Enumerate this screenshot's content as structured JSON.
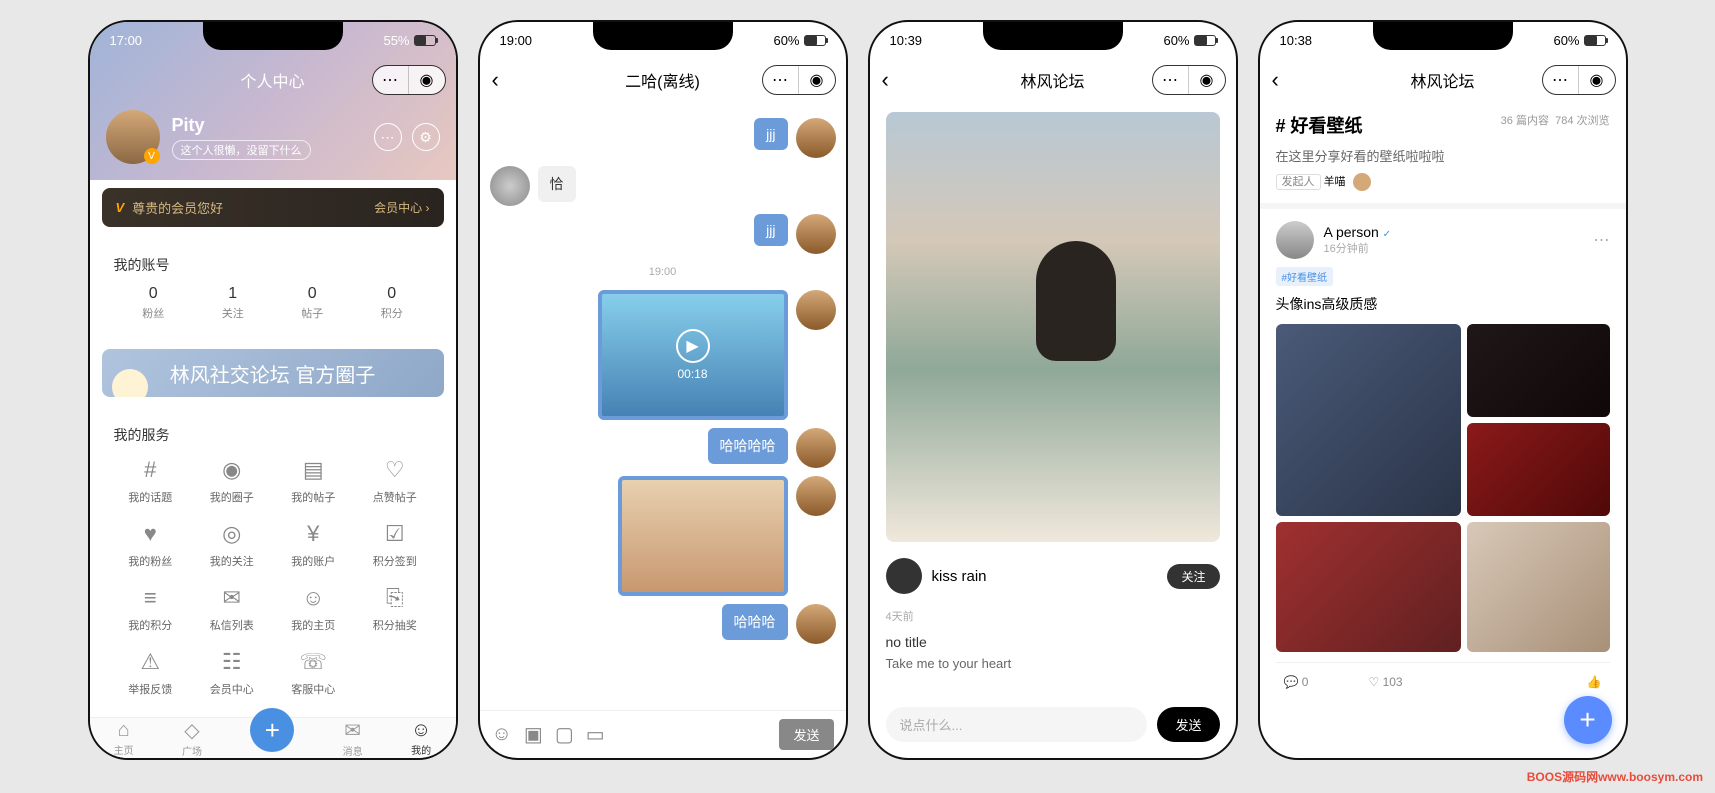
{
  "watermark": "BOOS源码网www.boosym.com",
  "p1": {
    "time": "17:00",
    "battery": "55%",
    "title": "个人中心",
    "user": {
      "name": "Pity",
      "desc": "这个人很懒，没留下什么"
    },
    "vip": {
      "text": "尊贵的会员您好",
      "link": "会员中心"
    },
    "account": {
      "title": "我的账号",
      "stats": [
        {
          "num": "0",
          "lbl": "粉丝"
        },
        {
          "num": "1",
          "lbl": "关注"
        },
        {
          "num": "0",
          "lbl": "帖子"
        },
        {
          "num": "0",
          "lbl": "积分"
        }
      ]
    },
    "banner": "林风社交论坛 官方圈子",
    "services": {
      "title": "我的服务",
      "items": [
        {
          "icon": "#",
          "lbl": "我的话题"
        },
        {
          "icon": "◉",
          "lbl": "我的圈子"
        },
        {
          "icon": "▤",
          "lbl": "我的帖子"
        },
        {
          "icon": "♡",
          "lbl": "点赞帖子"
        },
        {
          "icon": "♥",
          "lbl": "我的粉丝"
        },
        {
          "icon": "◎",
          "lbl": "我的关注"
        },
        {
          "icon": "¥",
          "lbl": "我的账户"
        },
        {
          "icon": "☑",
          "lbl": "积分签到"
        },
        {
          "icon": "≡",
          "lbl": "我的积分"
        },
        {
          "icon": "✉",
          "lbl": "私信列表"
        },
        {
          "icon": "☺",
          "lbl": "我的主页"
        },
        {
          "icon": "⎘",
          "lbl": "积分抽奖"
        },
        {
          "icon": "⚠",
          "lbl": "举报反馈"
        },
        {
          "icon": "☷",
          "lbl": "会员中心"
        },
        {
          "icon": "☏",
          "lbl": "客服中心"
        }
      ]
    },
    "tabs": [
      {
        "icon": "⌂",
        "lbl": "主页"
      },
      {
        "icon": "◇",
        "lbl": "广场"
      },
      {
        "icon": "✉",
        "lbl": "消息"
      },
      {
        "icon": "☺",
        "lbl": "我的"
      }
    ]
  },
  "p2": {
    "time": "19:00",
    "battery": "60%",
    "title": "二哈(离线)",
    "msgs": {
      "m1": "jjj",
      "m2": "恰",
      "m3": "jjj",
      "time": "19:00",
      "video_dur": "00:18",
      "m4": "哈哈哈哈",
      "m5": "哈哈哈"
    },
    "send": "发送"
  },
  "p3": {
    "time": "10:39",
    "battery": "60%",
    "title": "林风论坛",
    "author": "kiss rain",
    "follow": "关注",
    "meta": "4天前",
    "post_title": "no title",
    "post_sub": "Take me to your heart",
    "placeholder": "说点什么...",
    "send": "发送"
  },
  "p4": {
    "time": "10:38",
    "battery": "60%",
    "title": "林风论坛",
    "topic": {
      "title": "# 好看壁纸",
      "count": "36 篇内容",
      "views": "784 次浏览",
      "desc": "在这里分享好看的壁纸啦啦啦",
      "starter_lbl": "发起人",
      "starter": "羊喵"
    },
    "post": {
      "name": "A person",
      "time": "16分钟前",
      "tag": "#好看壁纸",
      "title": "头像ins高级质感",
      "comments": "0",
      "likes": "103"
    }
  }
}
